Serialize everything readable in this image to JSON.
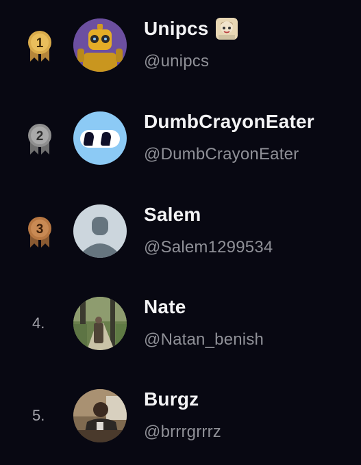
{
  "colors": {
    "background": "#080812",
    "name": "#f3f3f5",
    "handle": "#8f9097",
    "rank_text": "#a6a6ad",
    "gold": "#d9ab4b",
    "silver": "#a9a9a9",
    "bronze": "#c98a54"
  },
  "leaderboard": {
    "rows": [
      {
        "rank": "1",
        "medal": "gold",
        "name": "Unipcs",
        "handle": "@unipcs",
        "avatar_icon": "robot-avatar-icon",
        "badge_icon": "sticker-badge-icon"
      },
      {
        "rank": "2",
        "medal": "silver",
        "name": "DumbCrayonEater",
        "handle": "@DumbCrayonEater",
        "avatar_icon": "crayon-eyes-avatar-icon"
      },
      {
        "rank": "3",
        "medal": "bronze",
        "name": "Salem",
        "handle": "@Salem1299534",
        "avatar_icon": "default-person-avatar-icon"
      },
      {
        "rank": "4.",
        "name": "Nate",
        "handle": "@Natan_benish",
        "avatar_icon": "park-photo-avatar-icon"
      },
      {
        "rank": "5.",
        "name": "Burgz",
        "handle": "@brrrgrrrz",
        "avatar_icon": "office-photo-avatar-icon"
      }
    ]
  }
}
